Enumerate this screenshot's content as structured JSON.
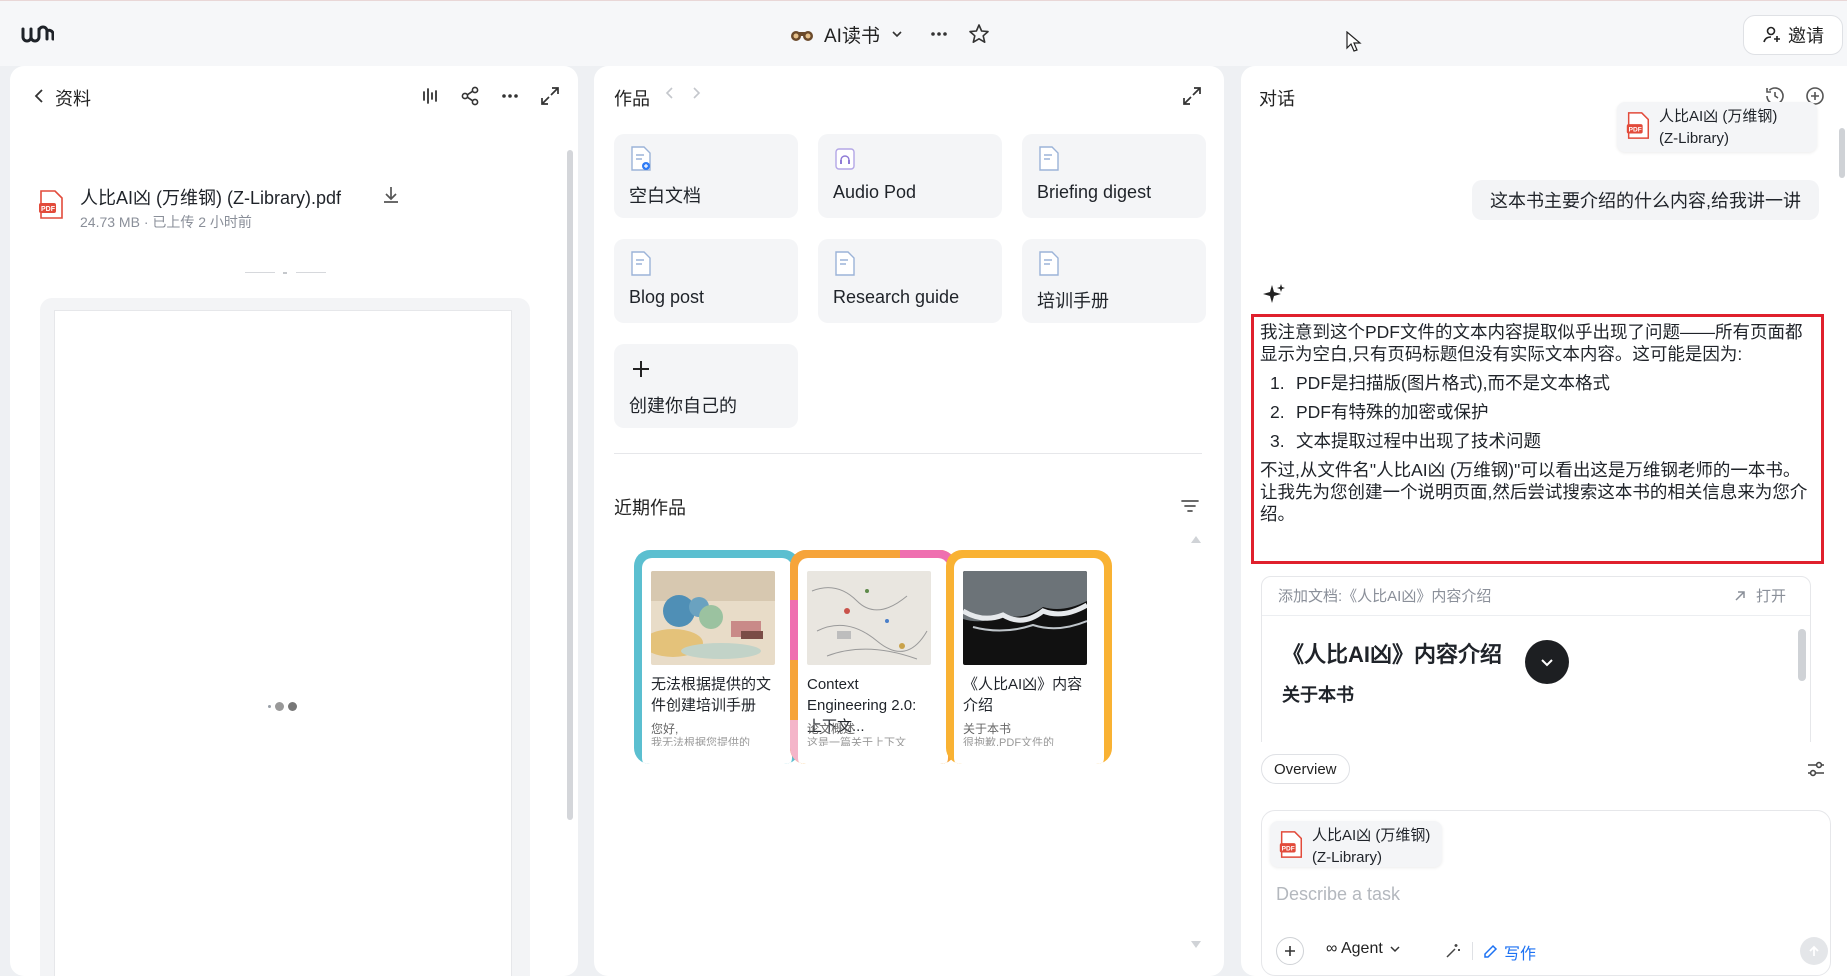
{
  "topbar": {
    "app_title": "AI读书",
    "invite_label": "邀请"
  },
  "left_panel": {
    "title": "资料",
    "file": {
      "name": "人比AI凶 (万维钢) (Z-Library).pdf",
      "meta": "24.73 MB · 已上传 2 小时前",
      "badge": "PDF"
    }
  },
  "middle_panel": {
    "title": "作品",
    "templates": [
      {
        "label": "空白文档",
        "icon": "blank-doc-icon"
      },
      {
        "label": "Audio Pod",
        "icon": "audio-doc-icon"
      },
      {
        "label": "Briefing digest",
        "icon": "doc-icon"
      },
      {
        "label": "Blog post",
        "icon": "doc-icon"
      },
      {
        "label": "Research guide",
        "icon": "doc-icon"
      },
      {
        "label": "培训手册",
        "icon": "doc-icon"
      },
      {
        "label": "创建你自己的",
        "icon": "plus-icon"
      }
    ],
    "recent_title": "近期作品",
    "recent": [
      {
        "title": "无法根据提供的文件创建培训手册",
        "sub": "您好,",
        "line": "我无法根据您提供的",
        "frame": "#5bbfd0"
      },
      {
        "title": "Context Engineering 2.0: 上下文...",
        "sub": "论文概述",
        "line": "这是一篇关于上下文",
        "frame": "#f6a43a"
      },
      {
        "title": "《人比AI凶》内容介绍",
        "sub": "关于本书",
        "line": "很抱歉,PDF文件的",
        "frame": "#f9b233"
      }
    ]
  },
  "right_panel": {
    "title": "对话",
    "attached_chip": "人比AI凶 (万维钢)\n(Z-Library)",
    "user_message": "这本书主要介绍的什么内容,给我讲一讲",
    "answer": {
      "intro": "我注意到这个PDF文件的文本内容提取似乎出现了问题——所有页面都显示为空白,只有页码标题但没有实际文本内容。这可能是因为:",
      "items": [
        "PDF是扫描版(图片格式),而不是文本格式",
        "PDF有特殊的加密或保护",
        "文本提取过程中出现了技术问题"
      ],
      "outro": "不过,从文件名\"人比AI凶 (万维钢)\"可以看出这是万维钢老师的一本书。让我先为您创建一个说明页面,然后尝试搜索这本书的相关信息来为您介绍。"
    },
    "doc_preview": {
      "header": "添加文档:《人比AI凶》内容介绍",
      "open_label": "打开",
      "heading": "《人比AI凶》内容介绍",
      "subheading": "关于本书"
    },
    "overview_label": "Overview",
    "input": {
      "chip": "人比AI凶 (万维钢)\n(Z-Library)",
      "placeholder": "Describe a task",
      "agent_label": "∞ Agent",
      "write_label": "写作"
    }
  },
  "colors": {
    "highlight_border": "#e0202d",
    "accent_blue": "#1d72f3"
  }
}
